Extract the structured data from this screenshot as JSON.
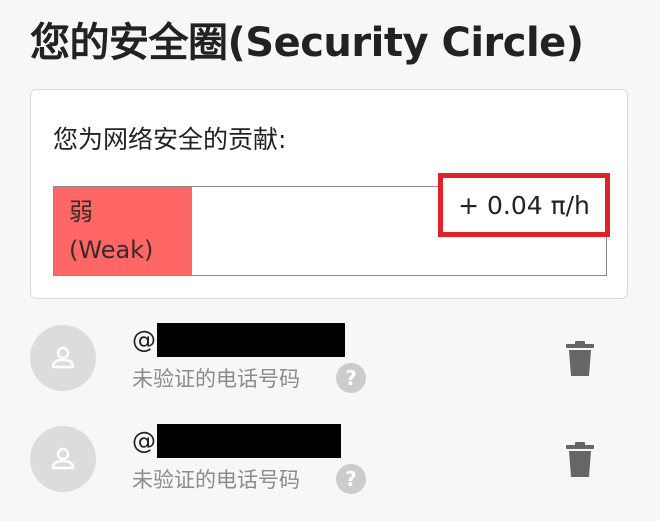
{
  "header": {
    "title": "您的安全圈(Security Circle)"
  },
  "contribution": {
    "label": "您为网络安全的贡献:",
    "level_cn": "弱",
    "level_en": "(Weak)",
    "rate": "+ 0.04 π/h",
    "colors": {
      "weak_fill": "#ff6666",
      "highlight_border": "#e0202a"
    }
  },
  "members": [
    {
      "handle_prefix": "@",
      "status": "未验证的电话号码",
      "help": "?",
      "icons": [
        "person-icon",
        "help-icon",
        "trash-icon"
      ]
    },
    {
      "handle_prefix": "@",
      "status": "未验证的电话号码",
      "help": "?",
      "icons": [
        "person-icon",
        "help-icon",
        "trash-icon"
      ]
    }
  ]
}
